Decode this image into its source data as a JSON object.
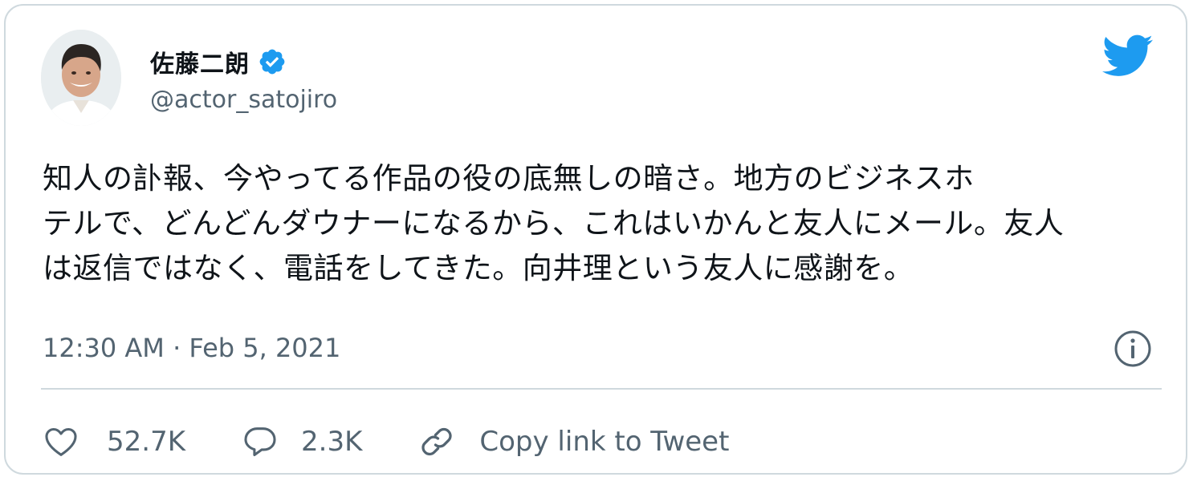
{
  "tweet": {
    "author": {
      "name": "佐藤二朗",
      "handle": "@actor_satojiro",
      "verified": true
    },
    "text": "知人の訃報、今やってる作品の役の底無しの暗さ。地方のビジネスホ\nテルで、どんどんダウナーになるから、これはいかんと友人にメール。友人\nは返信ではなく、電話をしてきた。向井理という友人に感謝を。",
    "timestamp": "12:30 AM · Feb 5, 2021",
    "actions": {
      "like_count": "52.7K",
      "reply_count": "2.3K",
      "copy_link_label": "Copy link to Tweet"
    }
  },
  "icons": {
    "brand": "twitter-bird-icon",
    "verified": "verified-badge-icon",
    "info": "info-icon",
    "like": "heart-icon",
    "reply": "speech-bubble-icon",
    "copy_link": "link-icon"
  },
  "colors": {
    "brand": "#1d9bf0",
    "secondary_text": "#536471",
    "primary_text": "#0f1419",
    "border": "#cfd9de"
  }
}
